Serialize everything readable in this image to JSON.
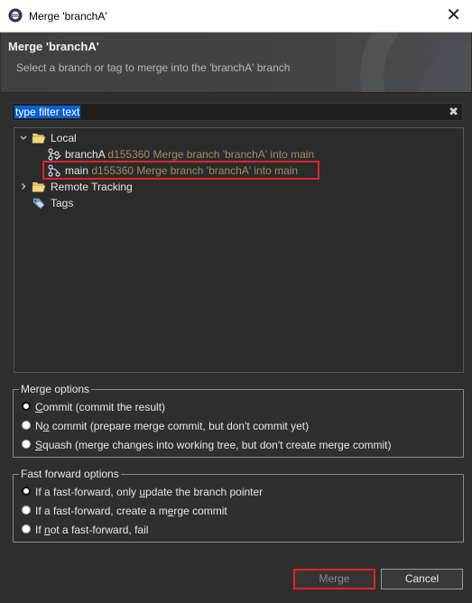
{
  "window": {
    "title": "Merge 'branchA'",
    "close_glyph": "✕"
  },
  "header": {
    "heading": "Merge 'branchA'",
    "subtitle": "Select a branch or tag to merge into the 'branchA' branch"
  },
  "filter": {
    "value": "type filter text",
    "clear_glyph": "✖"
  },
  "tree": {
    "local": {
      "label": "Local",
      "expanded": true,
      "branches": [
        {
          "name": "branchA",
          "commit": "d155360 Merge branch 'branchA' into main",
          "icon": "branch-checked-out-icon"
        },
        {
          "name": "main",
          "commit": "d155360 Merge branch 'branchA' into main",
          "icon": "branch-icon",
          "selected": true
        }
      ]
    },
    "remote": {
      "label": "Remote Tracking",
      "expanded": false
    },
    "tags": {
      "label": "Tags"
    }
  },
  "merge_options": {
    "legend": "Merge options",
    "selected": "commit",
    "items": [
      {
        "id": "commit",
        "mnemonic": "C",
        "rest": "ommit (commit the result)"
      },
      {
        "id": "no-commit",
        "pre": "N",
        "mnemonic": "o",
        "rest": " commit (prepare merge commit, but don't commit yet)"
      },
      {
        "id": "squash",
        "mnemonic": "S",
        "rest": "quash (merge changes into working tree, but don't create merge commit)"
      }
    ]
  },
  "ff_options": {
    "legend": "Fast forward options",
    "selected": "ff",
    "items": [
      {
        "id": "ff",
        "pre": "If a fast-forward, only ",
        "mnemonic": "u",
        "rest": "pdate the branch pointer"
      },
      {
        "id": "no-ff",
        "pre": "If a fast-forward, create a m",
        "mnemonic": "e",
        "rest": "rge commit"
      },
      {
        "id": "ff-only",
        "pre": "If ",
        "mnemonic": "n",
        "rest": "ot a fast-forward, fail"
      }
    ]
  },
  "buttons": {
    "merge": "Merge",
    "cancel": "Cancel"
  },
  "colors": {
    "highlight_border": "#e0242b",
    "selection_blue": "#0b61d1",
    "commit_meta": "#a08c61"
  }
}
